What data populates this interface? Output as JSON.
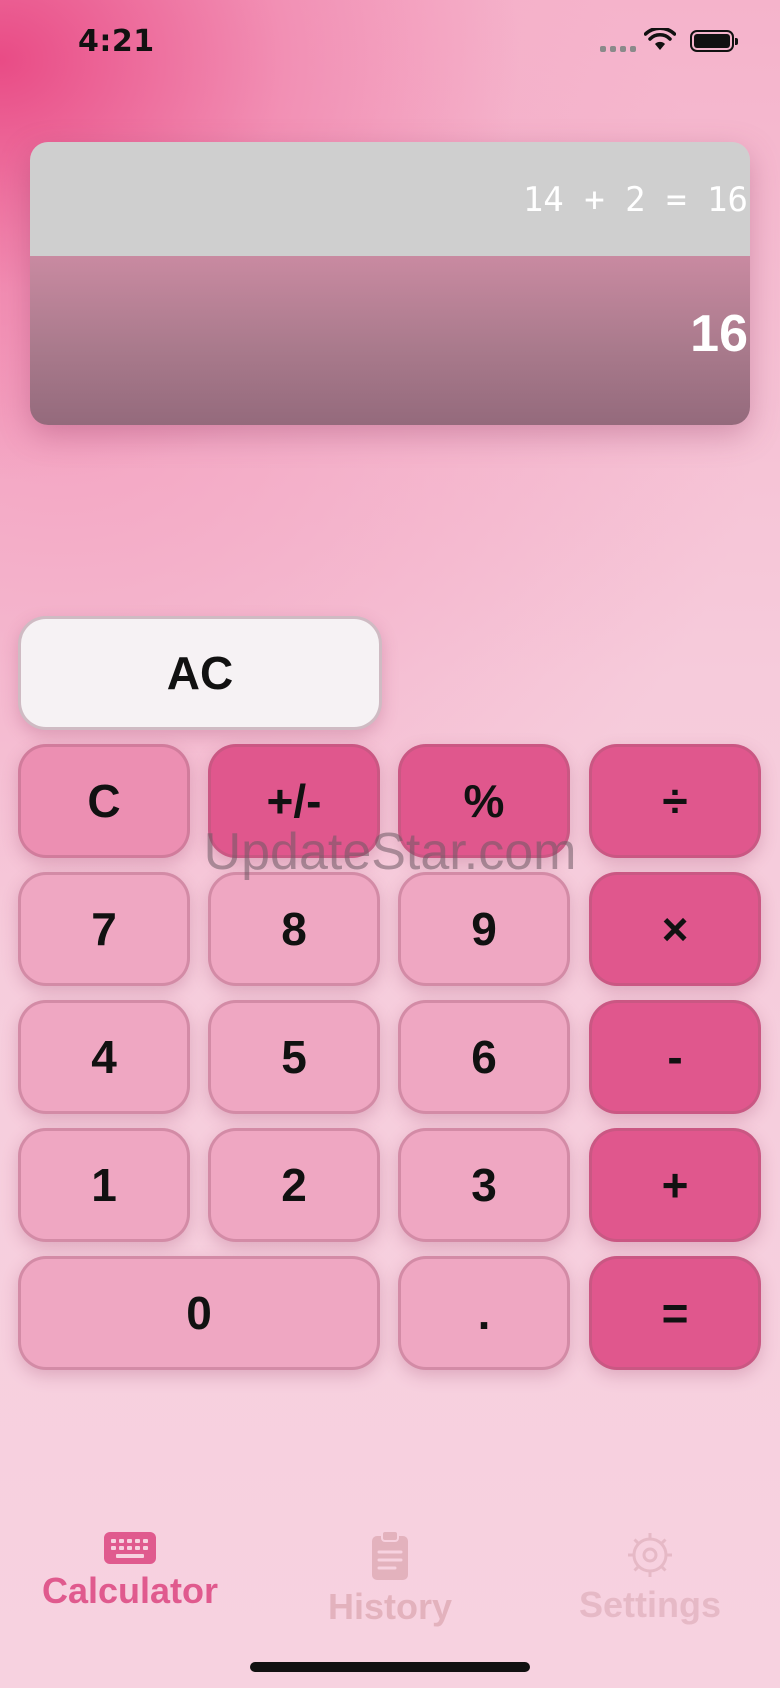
{
  "status": {
    "time": "4:21"
  },
  "display": {
    "history": "14 + 2 = 16",
    "result": "16"
  },
  "keys": {
    "ac": "AC",
    "c": "C",
    "sign": "+/-",
    "percent": "%",
    "divide": "÷",
    "seven": "7",
    "eight": "8",
    "nine": "9",
    "multiply": "×",
    "four": "4",
    "five": "5",
    "six": "6",
    "minus": "-",
    "one": "1",
    "two": "2",
    "three": "3",
    "plus": "+",
    "zero": "0",
    "decimal": ".",
    "equals": "="
  },
  "watermark": "UpdateStar.com",
  "tabs": {
    "calculator": "Calculator",
    "history": "History",
    "settings": "Settings"
  },
  "colors": {
    "active_tab": "#e05a8e",
    "inactive_tab": "#e3a9b9",
    "operator_key": "#e0578d",
    "number_key": "#efa7c2"
  },
  "icons": {
    "calculator": "keyboard-icon",
    "history": "clipboard-icon",
    "settings": "gear-icon"
  }
}
